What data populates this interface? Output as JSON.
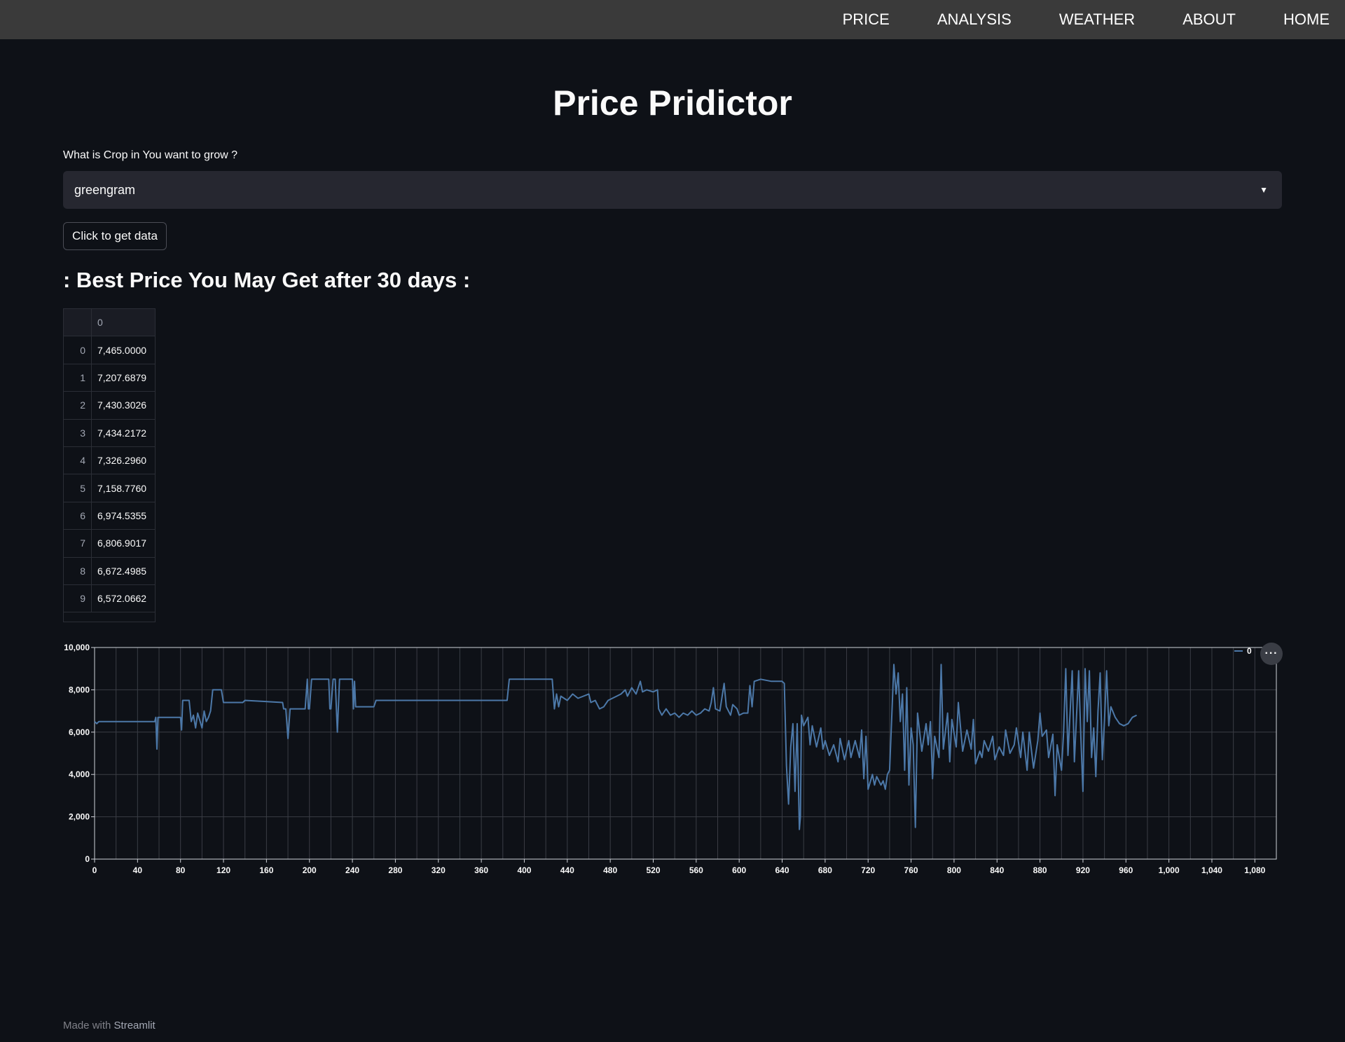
{
  "nav": {
    "items": [
      "PRICE",
      "ANALYSIS",
      "WEATHER",
      "ABOUT",
      "HOME"
    ]
  },
  "page": {
    "title": "Price Pridictor"
  },
  "crop_select": {
    "label": "What is Crop in You want to grow ?",
    "value": "greengram"
  },
  "get_data_button": {
    "label": "Click to get data"
  },
  "result": {
    "heading": ": Best Price You May Get after 30 days :"
  },
  "dataframe": {
    "column": "0",
    "rows": [
      {
        "index": "0",
        "value": "7,465.0000"
      },
      {
        "index": "1",
        "value": "7,207.6879"
      },
      {
        "index": "2",
        "value": "7,430.3026"
      },
      {
        "index": "3",
        "value": "7,434.2172"
      },
      {
        "index": "4",
        "value": "7,326.2960"
      },
      {
        "index": "5",
        "value": "7,158.7760"
      },
      {
        "index": "6",
        "value": "6,974.5355"
      },
      {
        "index": "7",
        "value": "6,806.9017"
      },
      {
        "index": "8",
        "value": "6,672.4985"
      },
      {
        "index": "9",
        "value": "6,572.0662"
      }
    ]
  },
  "chart_data": {
    "type": "line",
    "title": "",
    "xlabel": "",
    "ylabel": "",
    "xlim": [
      0,
      1100
    ],
    "ylim": [
      0,
      10000
    ],
    "x_ticks": [
      "0",
      "40",
      "80",
      "120",
      "160",
      "200",
      "240",
      "280",
      "320",
      "360",
      "400",
      "440",
      "480",
      "520",
      "560",
      "600",
      "640",
      "680",
      "720",
      "760",
      "800",
      "840",
      "880",
      "920",
      "960",
      "1,000",
      "1,040",
      "1,080"
    ],
    "y_ticks": [
      "0",
      "2,000",
      "4,000",
      "6,000",
      "8,000",
      "10,000"
    ],
    "grid": true,
    "legend": {
      "position": "top-right",
      "entries": [
        "0"
      ]
    },
    "color": "#4c78a8",
    "series": [
      {
        "name": "0",
        "points": [
          [
            0,
            6500
          ],
          [
            2,
            6400
          ],
          [
            4,
            6500
          ],
          [
            56,
            6500
          ],
          [
            57,
            6700
          ],
          [
            58,
            5200
          ],
          [
            59,
            6700
          ],
          [
            80,
            6700
          ],
          [
            81,
            6100
          ],
          [
            82,
            7500
          ],
          [
            88,
            7500
          ],
          [
            90,
            6500
          ],
          [
            92,
            6800
          ],
          [
            94,
            6200
          ],
          [
            96,
            6900
          ],
          [
            100,
            6200
          ],
          [
            102,
            7000
          ],
          [
            104,
            6500
          ],
          [
            106,
            6700
          ],
          [
            108,
            7000
          ],
          [
            110,
            8000
          ],
          [
            118,
            8000
          ],
          [
            120,
            7400
          ],
          [
            138,
            7400
          ],
          [
            140,
            7500
          ],
          [
            175,
            7400
          ],
          [
            176,
            7100
          ],
          [
            178,
            7100
          ],
          [
            180,
            5700
          ],
          [
            182,
            7100
          ],
          [
            196,
            7100
          ],
          [
            198,
            8500
          ],
          [
            199,
            7100
          ],
          [
            200,
            7100
          ],
          [
            202,
            8500
          ],
          [
            218,
            8500
          ],
          [
            219,
            7100
          ],
          [
            220,
            7100
          ],
          [
            222,
            8500
          ],
          [
            224,
            8500
          ],
          [
            226,
            6000
          ],
          [
            228,
            8500
          ],
          [
            240,
            8500
          ],
          [
            241,
            7100
          ],
          [
            242,
            8400
          ],
          [
            243,
            7200
          ],
          [
            260,
            7200
          ],
          [
            262,
            7500
          ],
          [
            384,
            7500
          ],
          [
            386,
            8500
          ],
          [
            426,
            8500
          ],
          [
            428,
            7100
          ],
          [
            430,
            7800
          ],
          [
            432,
            7200
          ],
          [
            434,
            7700
          ],
          [
            440,
            7500
          ],
          [
            445,
            7800
          ],
          [
            450,
            7600
          ],
          [
            455,
            7700
          ],
          [
            460,
            7800
          ],
          [
            462,
            7400
          ],
          [
            466,
            7500
          ],
          [
            470,
            7100
          ],
          [
            474,
            7200
          ],
          [
            478,
            7500
          ],
          [
            482,
            7600
          ],
          [
            486,
            7700
          ],
          [
            490,
            7800
          ],
          [
            494,
            8000
          ],
          [
            496,
            7700
          ],
          [
            500,
            8100
          ],
          [
            504,
            7800
          ],
          [
            508,
            8400
          ],
          [
            510,
            7900
          ],
          [
            514,
            8000
          ],
          [
            520,
            7900
          ],
          [
            524,
            8000
          ],
          [
            525,
            7100
          ],
          [
            528,
            6800
          ],
          [
            532,
            7100
          ],
          [
            536,
            6800
          ],
          [
            540,
            6900
          ],
          [
            544,
            6700
          ],
          [
            548,
            6900
          ],
          [
            552,
            6800
          ],
          [
            556,
            7000
          ],
          [
            560,
            6800
          ],
          [
            564,
            6900
          ],
          [
            568,
            7100
          ],
          [
            572,
            7000
          ],
          [
            574,
            7400
          ],
          [
            576,
            8100
          ],
          [
            578,
            7100
          ],
          [
            582,
            7000
          ],
          [
            586,
            8300
          ],
          [
            588,
            7200
          ],
          [
            592,
            6800
          ],
          [
            594,
            7300
          ],
          [
            598,
            7100
          ],
          [
            600,
            6800
          ],
          [
            604,
            6900
          ],
          [
            608,
            6900
          ],
          [
            610,
            8200
          ],
          [
            612,
            7200
          ],
          [
            614,
            8400
          ],
          [
            620,
            8500
          ],
          [
            630,
            8400
          ],
          [
            640,
            8400
          ],
          [
            642,
            8300
          ],
          [
            644,
            4400
          ],
          [
            646,
            2600
          ],
          [
            648,
            5300
          ],
          [
            650,
            6400
          ],
          [
            652,
            3200
          ],
          [
            654,
            6400
          ],
          [
            656,
            1400
          ],
          [
            657,
            2000
          ],
          [
            658,
            6800
          ],
          [
            660,
            6300
          ],
          [
            664,
            6700
          ],
          [
            666,
            5400
          ],
          [
            668,
            6300
          ],
          [
            672,
            5300
          ],
          [
            676,
            6200
          ],
          [
            678,
            5200
          ],
          [
            680,
            5600
          ],
          [
            684,
            4900
          ],
          [
            688,
            5400
          ],
          [
            692,
            4600
          ],
          [
            694,
            5700
          ],
          [
            698,
            4700
          ],
          [
            702,
            5600
          ],
          [
            704,
            4800
          ],
          [
            708,
            5600
          ],
          [
            712,
            4800
          ],
          [
            714,
            6100
          ],
          [
            716,
            3800
          ],
          [
            718,
            5800
          ],
          [
            720,
            3300
          ],
          [
            724,
            4000
          ],
          [
            726,
            3500
          ],
          [
            728,
            3900
          ],
          [
            732,
            3500
          ],
          [
            734,
            3700
          ],
          [
            736,
            3300
          ],
          [
            738,
            4000
          ],
          [
            740,
            4200
          ],
          [
            744,
            9200
          ],
          [
            746,
            7800
          ],
          [
            748,
            8800
          ],
          [
            750,
            6500
          ],
          [
            752,
            7800
          ],
          [
            754,
            4200
          ],
          [
            756,
            8100
          ],
          [
            758,
            3500
          ],
          [
            760,
            6200
          ],
          [
            762,
            5400
          ],
          [
            764,
            1500
          ],
          [
            766,
            6900
          ],
          [
            770,
            5100
          ],
          [
            774,
            6400
          ],
          [
            776,
            5400
          ],
          [
            778,
            6500
          ],
          [
            780,
            3800
          ],
          [
            782,
            5800
          ],
          [
            786,
            4800
          ],
          [
            788,
            9200
          ],
          [
            790,
            5200
          ],
          [
            794,
            6900
          ],
          [
            796,
            4600
          ],
          [
            798,
            6600
          ],
          [
            802,
            5300
          ],
          [
            804,
            7400
          ],
          [
            808,
            5100
          ],
          [
            812,
            6100
          ],
          [
            816,
            5200
          ],
          [
            818,
            6600
          ],
          [
            820,
            4500
          ],
          [
            824,
            5100
          ],
          [
            826,
            4800
          ],
          [
            828,
            5600
          ],
          [
            832,
            5100
          ],
          [
            836,
            5800
          ],
          [
            838,
            4700
          ],
          [
            842,
            5300
          ],
          [
            846,
            4900
          ],
          [
            848,
            6100
          ],
          [
            852,
            5000
          ],
          [
            856,
            5400
          ],
          [
            858,
            6200
          ],
          [
            862,
            4800
          ],
          [
            864,
            6000
          ],
          [
            868,
            4200
          ],
          [
            870,
            6000
          ],
          [
            874,
            4300
          ],
          [
            878,
            5600
          ],
          [
            880,
            6900
          ],
          [
            882,
            5800
          ],
          [
            886,
            6100
          ],
          [
            888,
            4800
          ],
          [
            892,
            5900
          ],
          [
            894,
            3000
          ],
          [
            896,
            5400
          ],
          [
            900,
            4200
          ],
          [
            902,
            6000
          ],
          [
            904,
            9000
          ],
          [
            906,
            4900
          ],
          [
            910,
            8900
          ],
          [
            912,
            4600
          ],
          [
            916,
            8900
          ],
          [
            918,
            5800
          ],
          [
            920,
            3200
          ],
          [
            922,
            9000
          ],
          [
            924,
            6500
          ],
          [
            926,
            8900
          ],
          [
            928,
            4800
          ],
          [
            930,
            6200
          ],
          [
            932,
            3900
          ],
          [
            934,
            7000
          ],
          [
            936,
            8800
          ],
          [
            938,
            4700
          ],
          [
            940,
            6500
          ],
          [
            942,
            8900
          ],
          [
            944,
            6300
          ],
          [
            946,
            7200
          ],
          [
            950,
            6700
          ],
          [
            954,
            6400
          ],
          [
            958,
            6300
          ],
          [
            962,
            6400
          ],
          [
            966,
            6700
          ],
          [
            970,
            6800
          ]
        ]
      }
    ]
  },
  "chart_menu": {
    "icon": "more-icon"
  },
  "footer": {
    "prefix": "Made with",
    "brand": "Streamlit"
  }
}
